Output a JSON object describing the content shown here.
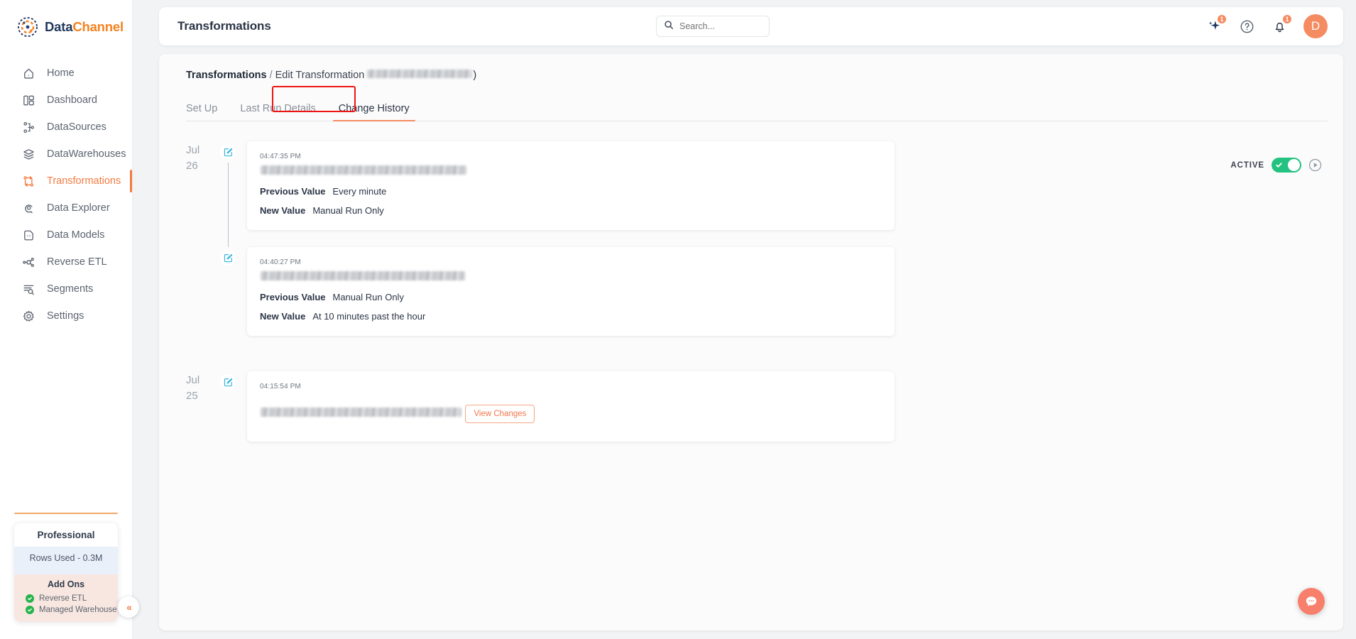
{
  "brand": {
    "part1": "Data",
    "part2": "Channel",
    "logo_icon": "datachannel-logo-icon"
  },
  "sidebar": {
    "items": [
      {
        "label": "Home",
        "icon": "home-icon",
        "active": false
      },
      {
        "label": "Dashboard",
        "icon": "dashboard-icon",
        "active": false
      },
      {
        "label": "DataSources",
        "icon": "datasources-icon",
        "active": false
      },
      {
        "label": "DataWarehouses",
        "icon": "datawarehouses-icon",
        "active": false
      },
      {
        "label": "Transformations",
        "icon": "transformations-icon",
        "active": true
      },
      {
        "label": "Data Explorer",
        "icon": "data-explorer-icon",
        "active": false
      },
      {
        "label": "Data Models",
        "icon": "data-models-icon",
        "active": false
      },
      {
        "label": "Reverse ETL",
        "icon": "reverse-etl-icon",
        "active": false
      },
      {
        "label": "Segments",
        "icon": "segments-icon",
        "active": false
      },
      {
        "label": "Settings",
        "icon": "settings-icon",
        "active": false
      }
    ],
    "plan": {
      "title": "Professional",
      "rows_used": "Rows Used - 0.3M",
      "addons_title": "Add Ons",
      "addons": [
        "Reverse ETL",
        "Managed Warehouse"
      ]
    },
    "collapse_label": "«",
    "accent_color": "#f47b41"
  },
  "topbar": {
    "title": "Transformations",
    "search_placeholder": "Search...",
    "search_value": "",
    "ai_badge": "1",
    "notification_badge": "1",
    "avatar_initial": "D"
  },
  "breadcrumb": {
    "root": "Transformations",
    "separator": "/",
    "current": "Edit Transformation",
    "redacted_suffix": "(",
    "close_paren": ")"
  },
  "tabs": {
    "items": [
      {
        "label": "Set Up",
        "active": false
      },
      {
        "label": "Last Run Details",
        "active": false
      },
      {
        "label": "Change History",
        "active": true
      }
    ],
    "highlighted_tab": "Change History"
  },
  "status": {
    "label": "ACTIVE",
    "enabled": true,
    "toggle_color": "#24c281",
    "run_icon": "play-circle-icon"
  },
  "timeline": {
    "groups": [
      {
        "date_month": "Jul",
        "date_day": "26",
        "entries": [
          {
            "time": "04:47:35 PM",
            "title_redacted": true,
            "fields": [
              {
                "label": "Previous Value",
                "value": "Every minute"
              },
              {
                "label": "New Value",
                "value": "Manual Run Only"
              }
            ],
            "button": null
          },
          {
            "time": "04:40:27 PM",
            "title_redacted": true,
            "fields": [
              {
                "label": "Previous Value",
                "value": "Manual Run Only"
              },
              {
                "label": "New Value",
                "value": "At 10 minutes past the hour"
              }
            ],
            "button": null
          }
        ]
      },
      {
        "date_month": "Jul",
        "date_day": "25",
        "entries": [
          {
            "time": "04:15:54 PM",
            "title_redacted": true,
            "fields": [],
            "button": "View Changes"
          }
        ]
      }
    ]
  },
  "chat": {
    "icon": "chat-bubble-icon"
  }
}
